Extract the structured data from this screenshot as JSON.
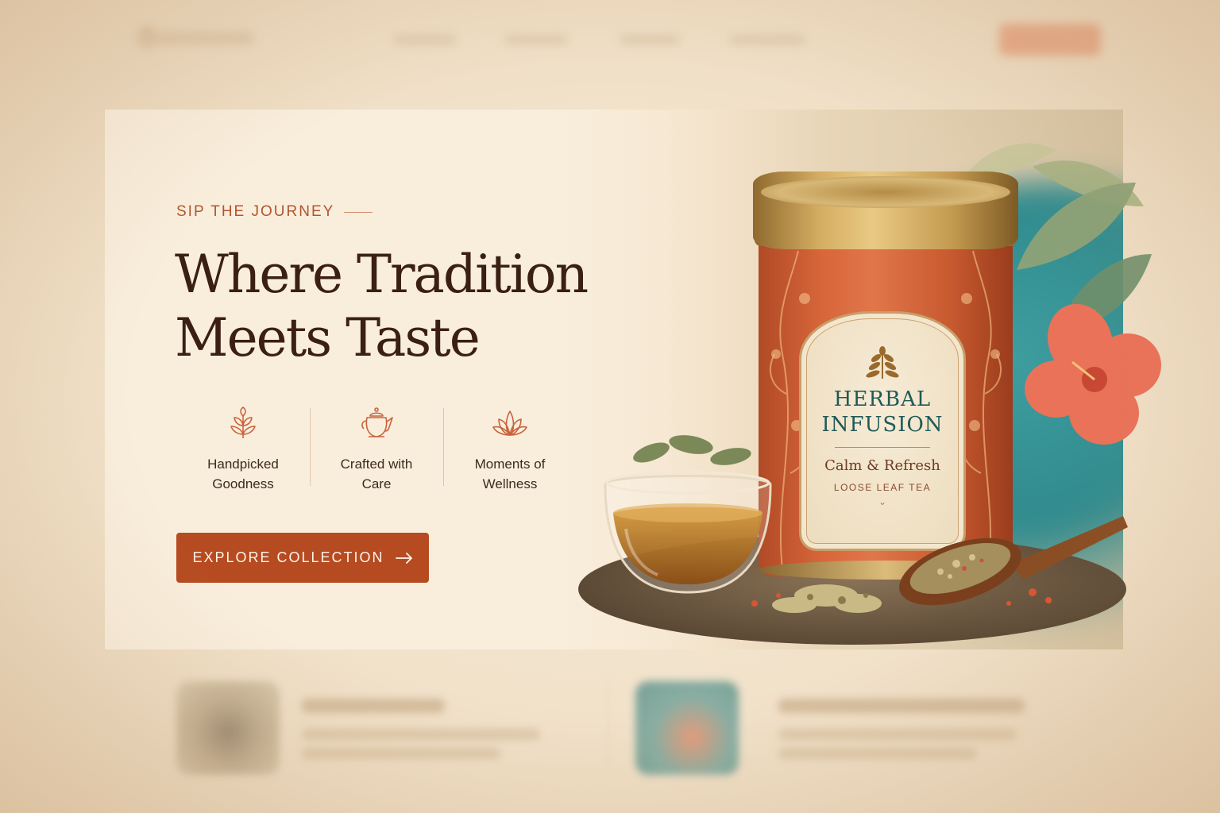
{
  "hero": {
    "eyebrow": "SIP THE JOURNEY",
    "headline_line1": "Where Tradition",
    "headline_line2": "Meets Taste",
    "cta_label": "EXPLORE COLLECTION",
    "cta_icon": "arrow-right-icon"
  },
  "features": [
    {
      "label": "Handpicked\nGoodness",
      "icon": "leaf-sprout-icon"
    },
    {
      "label": "Crafted with\nCare",
      "icon": "teapot-icon"
    },
    {
      "label": "Moments of\nWellness",
      "icon": "lotus-icon"
    }
  ],
  "product": {
    "brand_line1": "HERBAL",
    "brand_line2": "INFUSION",
    "tagline": "Calm & Refresh",
    "type": "LOOSE LEAF TEA"
  },
  "colors": {
    "accent": "#b64b21",
    "headline": "#3a1f12",
    "eyebrow": "#b4532e",
    "label_teal": "#1f5a56",
    "background": "#f3e7d4"
  }
}
